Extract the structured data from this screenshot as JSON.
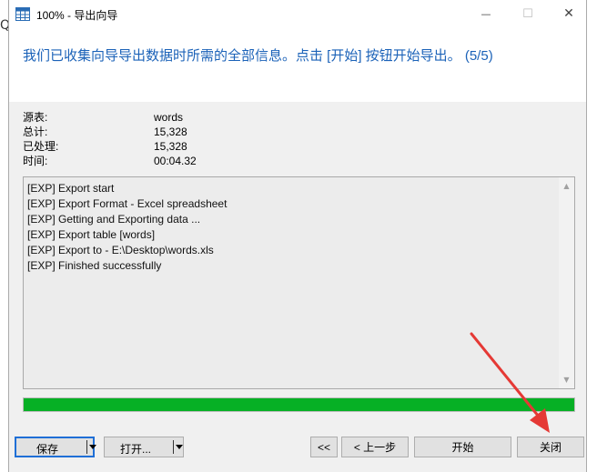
{
  "window": {
    "title": "100% - 导出向导",
    "min_glyph": "—",
    "max_glyph": "☐",
    "close_glyph": "✕"
  },
  "background_app": {
    "left_glyph": "Q"
  },
  "header": {
    "message": "我们已收集向导导出数据时所需的全部信息。点击 [开始] 按钮开始导出。 (5/5)"
  },
  "info": [
    {
      "label": "源表:",
      "value": "words"
    },
    {
      "label": "总计:",
      "value": "15,328"
    },
    {
      "label": "已处理:",
      "value": "15,328"
    },
    {
      "label": "时间:",
      "value": "00:04.32"
    }
  ],
  "log": {
    "lines": [
      "[EXP] Export start",
      "[EXP] Export Format - Excel spreadsheet",
      "[EXP] Getting and Exporting data ...",
      "[EXP] Export table [words]",
      "[EXP] Export to - E:\\Desktop\\words.xls",
      "[EXP] Finished successfully"
    ]
  },
  "progress": {
    "percent": 100,
    "color": "#06b025"
  },
  "buttons": {
    "save": "保存",
    "open": "打开...",
    "first": "<<",
    "prev": "< 上一步",
    "start": "开始",
    "close": "关闭"
  },
  "colors": {
    "accent": "#1b62b8",
    "focus_border": "#1f6fd6",
    "annotation_arrow": "#e53935"
  }
}
